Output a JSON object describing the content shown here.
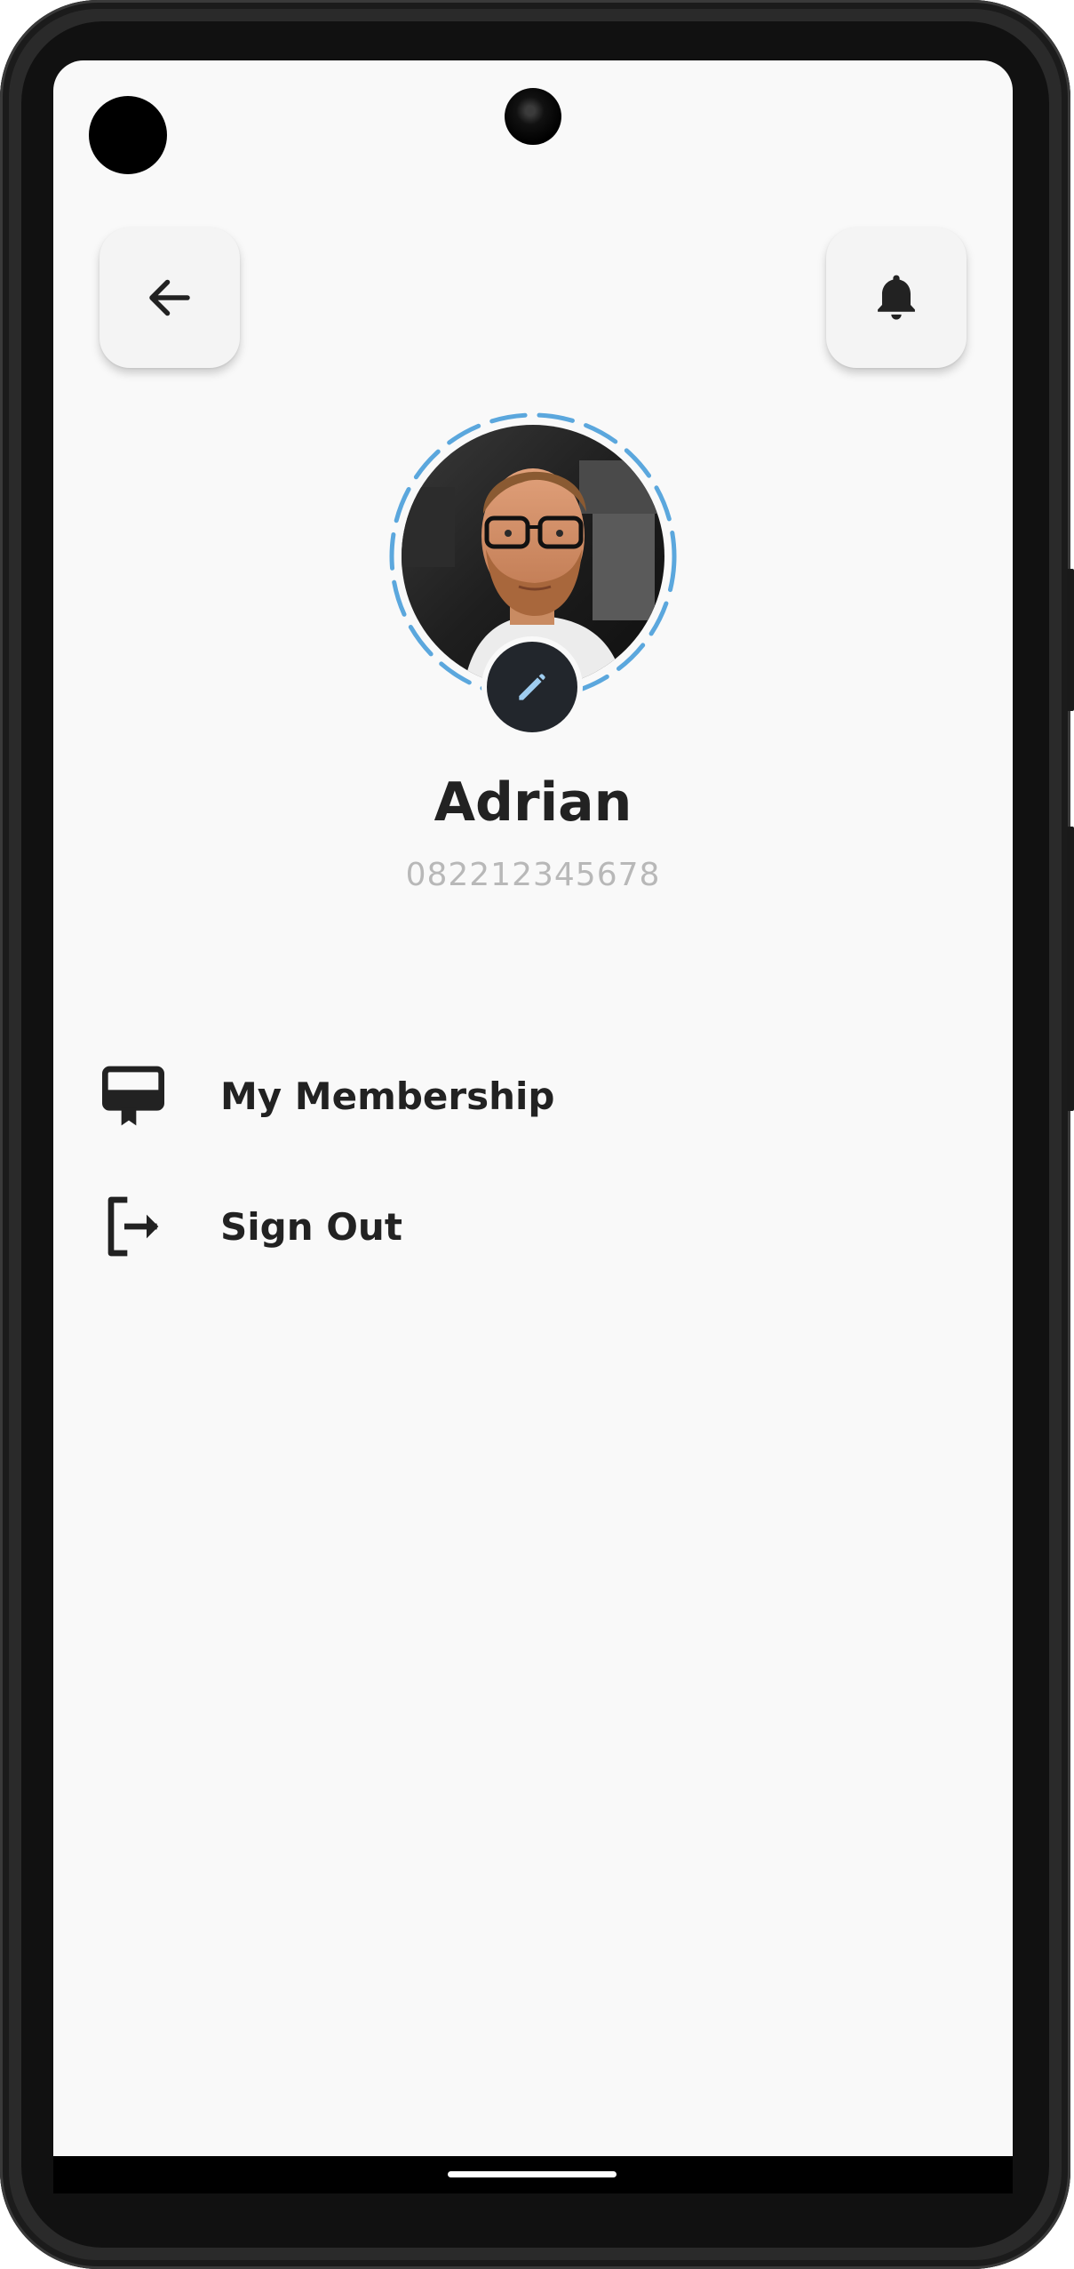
{
  "header": {
    "back_icon": "arrow-left-icon",
    "notification_icon": "bell-icon"
  },
  "profile": {
    "name": "Adrian",
    "phone": "082212345678",
    "edit_icon": "pencil-icon",
    "ring_color": "#5ba7dd"
  },
  "menu": {
    "items": [
      {
        "label": "My Membership",
        "icon": "membership-card-icon"
      },
      {
        "label": "Sign Out",
        "icon": "sign-out-icon"
      }
    ]
  },
  "colors": {
    "background": "#f9f9f9",
    "text_primary": "#222222",
    "text_secondary": "#b8b8b8",
    "edit_button": "#22262c",
    "edit_icon": "#9fcdf0"
  }
}
